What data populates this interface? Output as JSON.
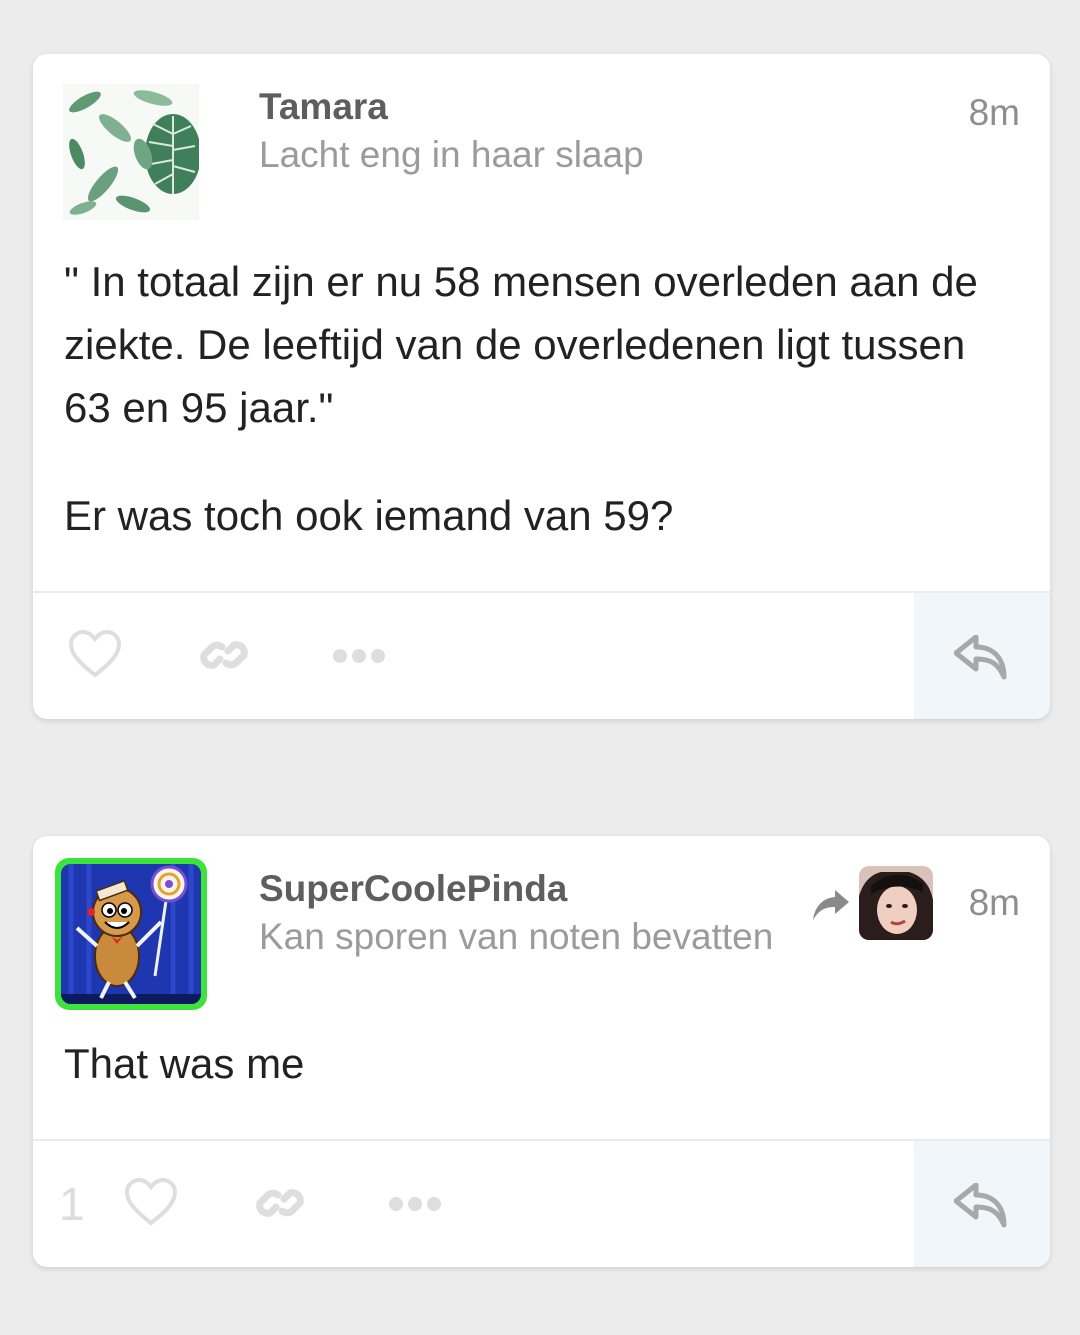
{
  "posts": [
    {
      "author": "Tamara",
      "tagline": "Lacht eng in haar slaap",
      "time": "8m",
      "body": [
        "\" In totaal zijn er nu 58 mensen overleden aan de ziekte. De leeftijd van de overledenen ligt tussen 63 en 95 jaar.\"",
        "Er was toch ook iemand van 59?"
      ],
      "like_count": "",
      "icons": [
        "heart-icon",
        "link-icon",
        "more-icon",
        "reply-icon"
      ]
    },
    {
      "author": "SuperCoolePinda",
      "tagline": "Kan sporen van noten bevatten",
      "time": "8m",
      "body": [
        "That was me"
      ],
      "like_count": "1",
      "icons": [
        "reshare-icon",
        "heart-icon",
        "link-icon",
        "more-icon",
        "reply-icon"
      ]
    }
  ],
  "colors": {
    "background": "#ececec",
    "card": "#ffffff",
    "reply_area": "#f1f6fa",
    "avatar_border": "#3de33d"
  }
}
